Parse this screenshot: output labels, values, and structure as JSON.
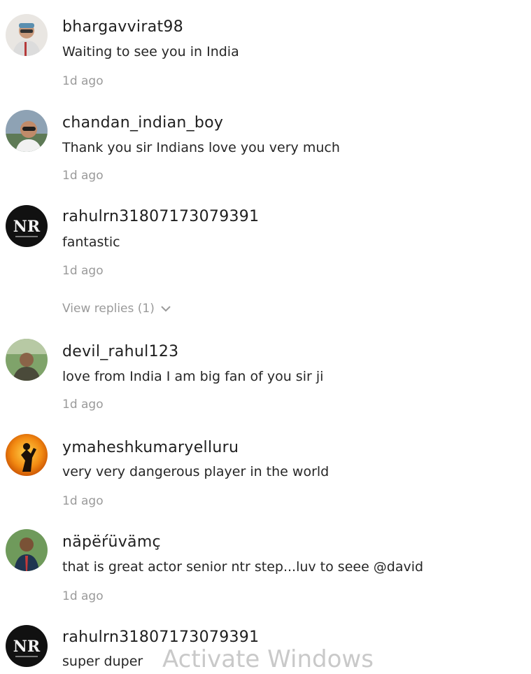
{
  "comments": [
    {
      "username": "bhargavvirat98",
      "text": "Waiting to see you in India",
      "time": "1d ago",
      "avatar": "selfie-avatar"
    },
    {
      "username": "chandan_indian_boy",
      "text": "Thank you sir Indians love you very much",
      "time": "1d ago",
      "avatar": "sunglasses-avatar"
    },
    {
      "username": "rahulrn31807173079391",
      "text": "fantastic",
      "time": "1d ago",
      "avatar": "nr-logo-avatar",
      "replies": "View replies (1)"
    },
    {
      "username": "devil_rahul123",
      "text": "love from India I am big fan of you sir ji",
      "time": "1d ago",
      "avatar": "outdoor-avatar"
    },
    {
      "username": "ymaheshkumaryelluru",
      "text": "very very dangerous player in the world",
      "time": "1d ago",
      "avatar": "hanuman-avatar"
    },
    {
      "username": "näpëŕüvämç",
      "text": "that is great actor senior ntr step...luv to seee @david",
      "time": "1d ago",
      "avatar": "suit-avatar"
    },
    {
      "username": "rahulrn31807173079391",
      "text": "super duper",
      "avatar": "nr-logo-avatar"
    }
  ],
  "watermark": "Activate Windows"
}
